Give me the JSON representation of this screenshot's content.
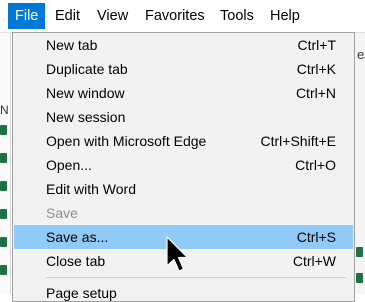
{
  "menubar": {
    "items": [
      {
        "label": "File",
        "active": true
      },
      {
        "label": "Edit"
      },
      {
        "label": "View"
      },
      {
        "label": "Favorites"
      },
      {
        "label": "Tools"
      },
      {
        "label": "Help"
      }
    ]
  },
  "background": {
    "right_fragment": "eA",
    "left_fragment": "N"
  },
  "file_menu": {
    "items": [
      {
        "label": "New tab",
        "shortcut": "Ctrl+T"
      },
      {
        "label": "Duplicate tab",
        "shortcut": "Ctrl+K"
      },
      {
        "label": "New window",
        "shortcut": "Ctrl+N"
      },
      {
        "label": "New session",
        "shortcut": ""
      },
      {
        "label": "Open with Microsoft Edge",
        "shortcut": "Ctrl+Shift+E"
      },
      {
        "label": "Open...",
        "shortcut": "Ctrl+O"
      },
      {
        "label": "Edit with Word",
        "shortcut": ""
      },
      {
        "label": "Save",
        "shortcut": "",
        "disabled": true
      },
      {
        "label": "Save as...",
        "shortcut": "Ctrl+S",
        "highlighted": true
      },
      {
        "label": "Close tab",
        "shortcut": "Ctrl+W"
      },
      {
        "label": "Page setup",
        "shortcut": ""
      }
    ]
  },
  "colors": {
    "menubar_active": "#0078d7",
    "highlight": "#91c9f7",
    "menu_bg": "#f2f2f2",
    "disabled_text": "#8d8d8d"
  }
}
